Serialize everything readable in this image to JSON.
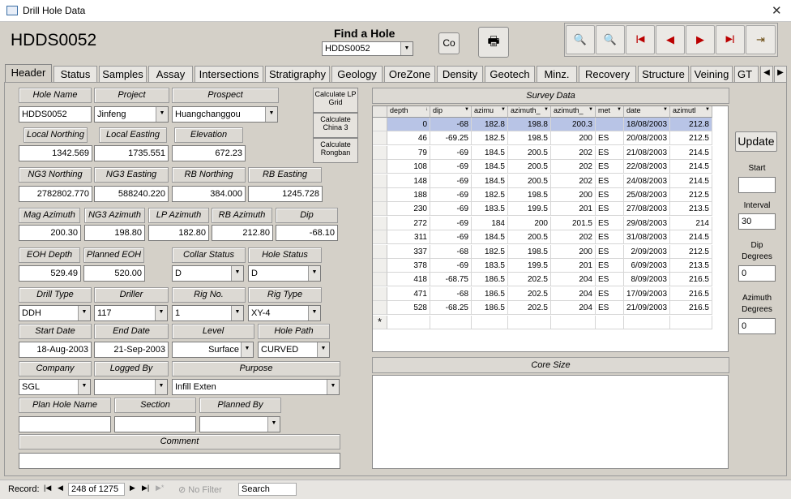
{
  "window": {
    "title": "Drill Hole Data",
    "close": "✕"
  },
  "header": {
    "hole_id": "HDDS0052",
    "find_label": "Find a Hole",
    "find_value": "HDDS0052",
    "co_label": "Co",
    "print_icon": "🖶"
  },
  "nav": [
    {
      "name": "preview-icon",
      "glyph": "🔍"
    },
    {
      "name": "preview2-icon",
      "glyph": "🔍"
    },
    {
      "name": "first-record-icon",
      "glyph": "⏮"
    },
    {
      "name": "prev-record-icon",
      "glyph": "◀"
    },
    {
      "name": "next-record-icon",
      "glyph": "▶"
    },
    {
      "name": "last-record-icon",
      "glyph": "⏭"
    },
    {
      "name": "exit-icon",
      "glyph": "🚪"
    }
  ],
  "tabs": [
    "Header",
    "Status",
    "Samples",
    "Assay",
    "Intersections",
    "Stratigraphy",
    "Geology",
    "OreZone",
    "Density",
    "Geotech",
    "Minz.",
    "Recovery",
    "Structure",
    "Veining",
    "GT"
  ],
  "form": {
    "hole_name_lbl": "Hole Name",
    "hole_name": "HDDS0052",
    "project_lbl": "Project",
    "project": "Jinfeng",
    "prospect_lbl": "Prospect",
    "prospect": "Huangchanggou",
    "local_northing_lbl": "Local Northing",
    "local_northing": "1342.569",
    "local_easting_lbl": "Local Easting",
    "local_easting": "1735.551",
    "elevation_lbl": "Elevation",
    "elevation": "672.23",
    "ng3_northing_lbl": "NG3 Northing",
    "ng3_northing": "2782802.770",
    "ng3_easting_lbl": "NG3 Easting",
    "ng3_easting": "588240.220",
    "rb_northing_lbl": "RB Northing",
    "rb_northing": "384.000",
    "rb_easting_lbl": "RB Easting",
    "rb_easting": "1245.728",
    "mag_az_lbl": "Mag Azimuth",
    "mag_az": "200.30",
    "ng3_az_lbl": "NG3 Azimuth",
    "ng3_az": "198.80",
    "lp_az_lbl": "LP Azimuth",
    "lp_az": "182.80",
    "rb_az_lbl": "RB Azimuth",
    "rb_az": "212.80",
    "dip_lbl": "Dip",
    "dip": "-68.10",
    "eoh_lbl": "EOH Depth",
    "eoh": "529.49",
    "planned_eoh_lbl": "Planned EOH",
    "planned_eoh": "520.00",
    "collar_lbl": "Collar Status",
    "collar": "D",
    "hole_status_lbl": "Hole Status",
    "hole_status": "D",
    "drill_type_lbl": "Drill Type",
    "drill_type": "DDH",
    "driller_lbl": "Driller",
    "driller": "117",
    "rig_no_lbl": "Rig No.",
    "rig_no": "1",
    "rig_type_lbl": "Rig Type",
    "rig_type": "XY-4",
    "start_lbl": "Start Date",
    "start": "18-Aug-2003",
    "end_lbl": "End Date",
    "end": "21-Sep-2003",
    "level_lbl": "Level",
    "level": "Surface",
    "path_lbl": "Hole Path",
    "path": "CURVED",
    "company_lbl": "Company",
    "company": "SGL",
    "logged_lbl": "Logged By",
    "logged": "",
    "purpose_lbl": "Purpose",
    "purpose": "Infill Exten",
    "plan_name_lbl": "Plan Hole Name",
    "plan_name": "",
    "section_lbl": "Section",
    "section": "",
    "planned_by_lbl": "Planned By",
    "planned_by": "",
    "comment_lbl": "Comment",
    "comment": ""
  },
  "calc": {
    "lp": "Calculate LP Grid",
    "china": "Calculate China 3",
    "rongban": "Calculate Rongban"
  },
  "survey": {
    "title": "Survey Data",
    "columns": [
      "depth",
      "dip",
      "azimu",
      "azimuth_",
      "azimuth_",
      "met",
      "date",
      "azimutl"
    ],
    "rows": [
      [
        "0",
        "-68",
        "182.8",
        "198.8",
        "200.3",
        "",
        "18/08/2003",
        "212.8"
      ],
      [
        "46",
        "-69.25",
        "182.5",
        "198.5",
        "200",
        "ES",
        "20/08/2003",
        "212.5"
      ],
      [
        "79",
        "-69",
        "184.5",
        "200.5",
        "202",
        "ES",
        "21/08/2003",
        "214.5"
      ],
      [
        "108",
        "-69",
        "184.5",
        "200.5",
        "202",
        "ES",
        "22/08/2003",
        "214.5"
      ],
      [
        "148",
        "-69",
        "184.5",
        "200.5",
        "202",
        "ES",
        "24/08/2003",
        "214.5"
      ],
      [
        "188",
        "-69",
        "182.5",
        "198.5",
        "200",
        "ES",
        "25/08/2003",
        "212.5"
      ],
      [
        "230",
        "-69",
        "183.5",
        "199.5",
        "201",
        "ES",
        "27/08/2003",
        "213.5"
      ],
      [
        "272",
        "-69",
        "184",
        "200",
        "201.5",
        "ES",
        "29/08/2003",
        "214"
      ],
      [
        "311",
        "-69",
        "184.5",
        "200.5",
        "202",
        "ES",
        "31/08/2003",
        "214.5"
      ],
      [
        "337",
        "-68",
        "182.5",
        "198.5",
        "200",
        "ES",
        "2/09/2003",
        "212.5"
      ],
      [
        "378",
        "-69",
        "183.5",
        "199.5",
        "201",
        "ES",
        "6/09/2003",
        "213.5"
      ],
      [
        "418",
        "-68.75",
        "186.5",
        "202.5",
        "204",
        "ES",
        "8/09/2003",
        "216.5"
      ],
      [
        "471",
        "-68",
        "186.5",
        "202.5",
        "204",
        "ES",
        "17/09/2003",
        "216.5"
      ],
      [
        "528",
        "-68.25",
        "186.5",
        "202.5",
        "204",
        "ES",
        "21/09/2003",
        "216.5"
      ]
    ],
    "new_row": "*"
  },
  "core_size": {
    "title": "Core Size"
  },
  "right": {
    "update": "Update",
    "start_lbl": "Start",
    "start": "",
    "interval_lbl": "Interval",
    "interval": "30",
    "dip_lbl": "Dip Degrees",
    "dip": "0",
    "az_lbl": "Azimuth Degrees",
    "az": "0"
  },
  "status": {
    "record_lbl": "Record:",
    "record": "248 of 1275",
    "filter": "No Filter",
    "search": "Search"
  }
}
